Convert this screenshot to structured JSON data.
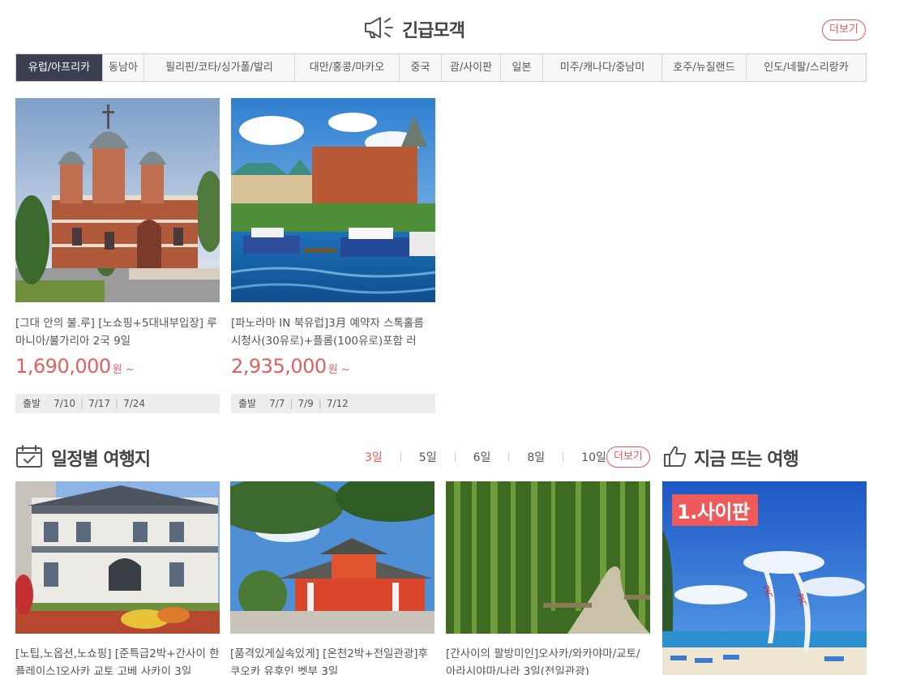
{
  "urgent": {
    "title": "긴급모객",
    "more_label": "더보기",
    "tabs": [
      {
        "label": "유럽/아프리카",
        "active": true
      },
      {
        "label": "동남아",
        "active": false
      },
      {
        "label": "필리핀/코타/싱가폴/발리",
        "active": false
      },
      {
        "label": "대만/홍콩/마카오",
        "active": false
      },
      {
        "label": "중국",
        "active": false
      },
      {
        "label": "괌/사이판",
        "active": false
      },
      {
        "label": "일본",
        "active": false
      },
      {
        "label": "미주/캐나다/중남미",
        "active": false
      },
      {
        "label": "호주/뉴질랜드",
        "active": false
      },
      {
        "label": "인도/네팔/스리랑카",
        "active": false
      }
    ],
    "products": [
      {
        "title": "[그대 안의 불.루] [노쇼핑+5대내부입장] 루마니아/불가리아 2국 9일",
        "price": "1,690,000",
        "unit": "원 ~",
        "depart_label": "출발",
        "dates": [
          "7/10",
          "7/17",
          "7/24"
        ]
      },
      {
        "title": "[파노라마 IN 북유럽]3月 예약자 스톡홀름 시청사(30유로)+플롬(100유로)포함 러",
        "price": "2,935,000",
        "unit": "원 ~",
        "depart_label": "출발",
        "dates": [
          "7/7",
          "7/9",
          "7/12"
        ]
      }
    ]
  },
  "schedule": {
    "title": "일정별 여행지",
    "more_label": "더보기",
    "day_tabs": [
      {
        "label": "3일",
        "active": true
      },
      {
        "label": "5일",
        "active": false
      },
      {
        "label": "6일",
        "active": false
      },
      {
        "label": "8일",
        "active": false
      },
      {
        "label": "10일 이상",
        "active": false
      }
    ],
    "products": [
      {
        "title": "[노팁,노옵션,노쇼핑] [준특급2박+간사이 한플레이스]오사카 교토 고베 사카이 3일"
      },
      {
        "title": "[품격있게실속있게] [온천2박+전일관광]후쿠오카 유후인 벳부 3일"
      },
      {
        "title": "[간사이의 팔방미인]오사카/와카야마/교토/아라시야마/나라 3일(전일관광)"
      }
    ]
  },
  "hot": {
    "title": "지금 뜨는 여행",
    "rank_label": "1.사이판"
  },
  "colors": {
    "accent": "#e05a5a",
    "active_tab": "#3b3f52"
  }
}
